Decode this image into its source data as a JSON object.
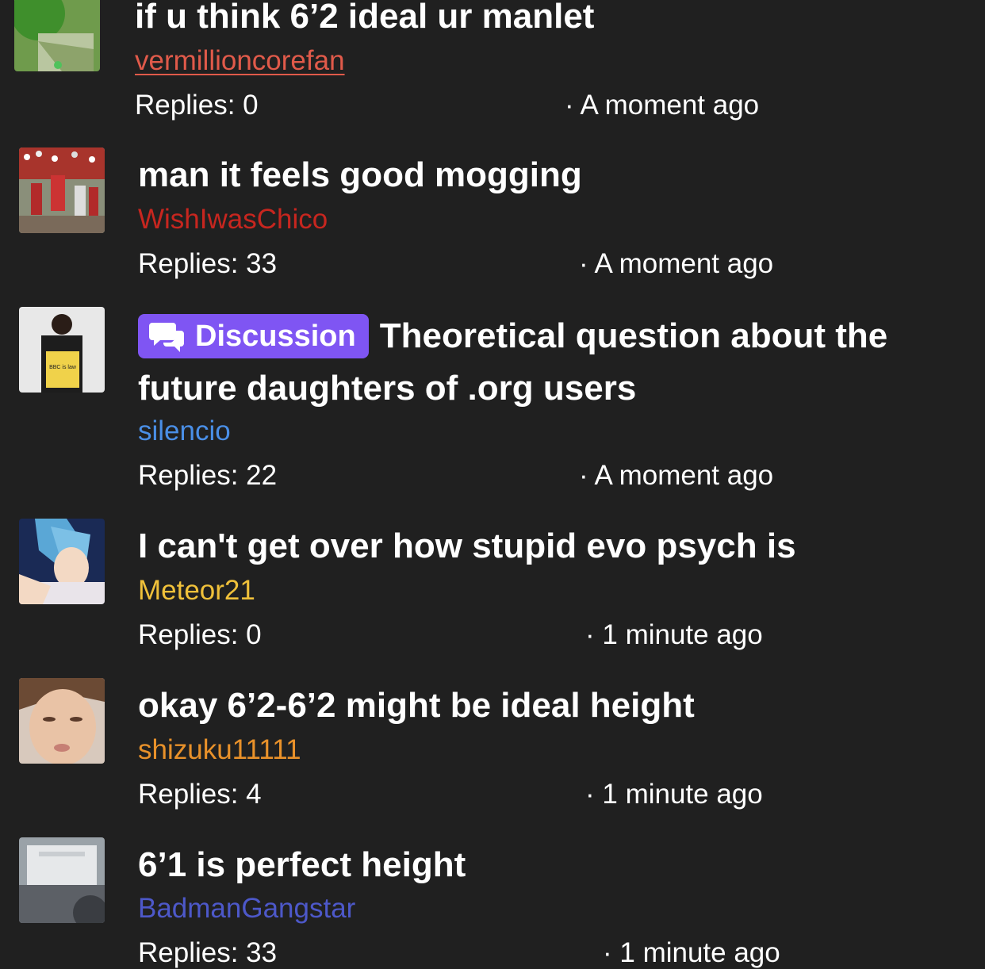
{
  "threads": [
    {
      "title": "if u think 6’2 ideal ur manlet",
      "author": "vermillioncorefan",
      "author_color": "#e05a4a",
      "replies": "Replies: 0",
      "time": "· A moment ago",
      "avatar_icon": "green-portrait-avatar"
    },
    {
      "title": "man it feels good mogging",
      "author": "WishIwasChico",
      "author_color": "#c7261f",
      "replies": "Replies: 33",
      "time": "· A moment ago",
      "avatar_icon": "football-stadium-avatar"
    },
    {
      "badge": "Discussion",
      "badge_icon": "chat-bubbles-icon",
      "title": "Theoretical question about the future daughters of .org users",
      "author": "silencio",
      "author_color": "#4a8fe7",
      "replies": "Replies: 22",
      "time": "· A moment ago",
      "avatar_icon": "man-with-sign-avatar",
      "avatar_sign_text": "BBC is law"
    },
    {
      "title": "I can't get over how stupid evo psych is",
      "author": "Meteor21",
      "author_color": "#f0c13a",
      "replies": "Replies: 0",
      "time": "· 1 minute ago",
      "avatar_icon": "anime-character-avatar"
    },
    {
      "title": "okay 6’2-6’2 might be ideal height",
      "author": "shizuku11111",
      "author_color": "#e8912a",
      "replies": "Replies: 4",
      "time": "· 1 minute ago",
      "avatar_icon": "face-photo-avatar"
    },
    {
      "title": "6’1 is perfect height",
      "author": "BadmanGangstar",
      "author_color": "#4d58c9",
      "replies": "Replies: 33",
      "time": "· 1 minute ago",
      "avatar_icon": "car-interior-avatar"
    }
  ]
}
